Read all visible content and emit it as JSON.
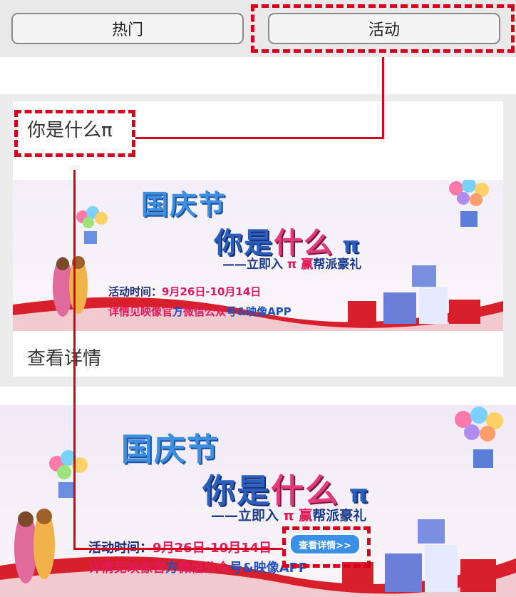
{
  "tabs": {
    "hot": "热门",
    "activity": "活动"
  },
  "card": {
    "title": "你是什么π",
    "link": "查看详情"
  },
  "banner": {
    "title1": "国庆节",
    "title2a": "你是",
    "title2b": "什么",
    "title2c": " π",
    "sub_prefix": "——立即入",
    "sub_pi": " π ",
    "sub_red": "赢",
    "sub_rest": "帮派豪礼",
    "time_label": "活动时间：",
    "time_value": "9月26日-10月14日",
    "detail_1": "详情见",
    "detail_2": "映像官",
    "detail_3": "方",
    "detail_4": "微信公众",
    "detail_5": "号&映像APP",
    "button": "查看详情>>"
  },
  "colors": {
    "annotation": "#d6001c",
    "tabbar": "#e9e9e9"
  }
}
